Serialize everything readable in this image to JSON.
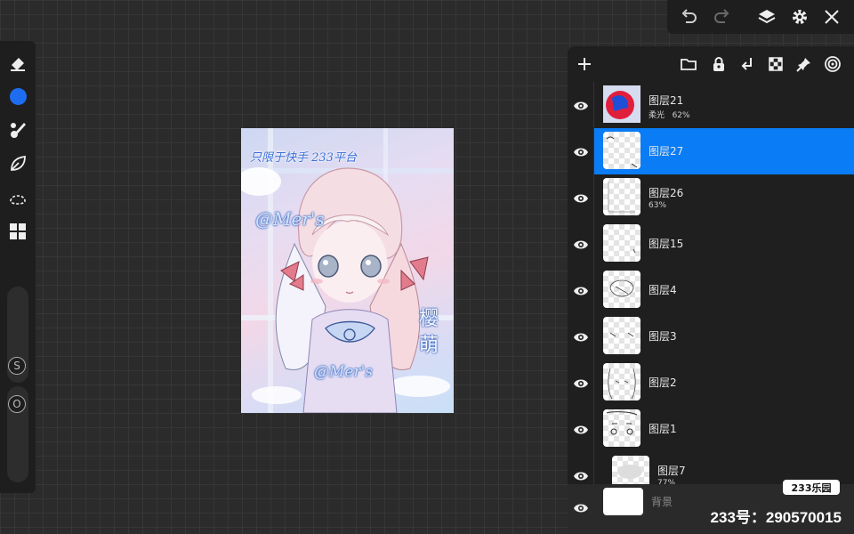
{
  "toolbar": {
    "tools": [
      {
        "icon": "eraser-icon"
      },
      {
        "icon": "color-swatch-icon",
        "color": "#1e6df0"
      },
      {
        "icon": "brush-icon"
      },
      {
        "icon": "smudge-leaf-icon"
      },
      {
        "icon": "lasso-icon"
      },
      {
        "icon": "adjust-grid-icon"
      }
    ],
    "size_slider": {
      "badge": "S"
    },
    "opacity_slider": {
      "badge": "O"
    }
  },
  "topbar": {
    "icons": [
      "undo-icon",
      "redo-icon",
      "layers-icon",
      "settings-icon",
      "close-icon"
    ]
  },
  "canvas": {
    "artwork": {
      "title_text": "只限于快手 233平台",
      "signature_top": "@Mer's",
      "signature_bottom": "@Mer's",
      "side_text": "樱萌"
    }
  },
  "layers_panel": {
    "header_icons": [
      "add-layer-icon",
      "folder-icon",
      "lock-icon",
      "merge-down-icon",
      "transparency-icon",
      "pin-icon",
      "target-icon"
    ],
    "layers": [
      {
        "name": "图层21",
        "sub": "柔光   62%",
        "selected": false
      },
      {
        "name": "图层27",
        "sub": "",
        "selected": true
      },
      {
        "name": "图层26",
        "sub": "63%",
        "selected": false
      },
      {
        "name": "图层15",
        "sub": "",
        "selected": false
      },
      {
        "name": "图层4",
        "sub": "",
        "selected": false
      },
      {
        "name": "图层3",
        "sub": "",
        "selected": false
      },
      {
        "name": "图层2",
        "sub": "",
        "selected": false
      },
      {
        "name": "图层1",
        "sub": "",
        "selected": false
      },
      {
        "name": "图层7",
        "sub": "77%",
        "selected": false
      }
    ],
    "background_layer": {
      "name": "背景"
    }
  },
  "watermark": {
    "logo": "233乐园",
    "id_text": "233号：290570015"
  },
  "colors": {
    "accent": "#0a7cf5",
    "panel": "#1f1f1f"
  }
}
